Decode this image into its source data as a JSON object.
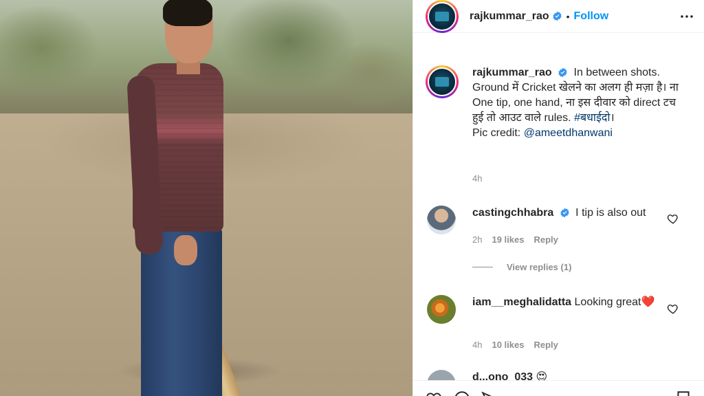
{
  "post": {
    "username": "rajkummar_rao",
    "follow_label": "Follow",
    "separator": "•"
  },
  "caption": {
    "username": "rajkummar_rao",
    "text": "In between shots. Ground में Cricket खेलने का अलग ही मज़ा है। ना One tip, one hand, ना इस दीवार को direct टच हुई तो आउट वाले rules.",
    "hashtag": "#बधाईदो",
    "hashtag_suffix": "।",
    "credit_label": "Pic credit:",
    "credit_mention": "@ameetdhanwani",
    "time": "4h"
  },
  "comments": [
    {
      "username": "castingchhabra",
      "text": "I tip is also out",
      "time": "2h",
      "likes": "19 likes",
      "reply_label": "Reply",
      "view_replies": "View replies (1)"
    },
    {
      "username": "iam__meghalidatta",
      "text": "Looking great❤️",
      "time": "4h",
      "likes": "10 likes",
      "reply_label": "Reply"
    },
    {
      "username": "d...ono_033",
      "text": "😍"
    }
  ],
  "colors": {
    "accent": "#0095f6",
    "link": "#00376b",
    "muted": "#8e8e8e",
    "text": "#262626"
  },
  "icons": [
    "verified-badge-icon",
    "more-options-icon",
    "heart-icon",
    "comment-icon",
    "share-icon",
    "bookmark-icon"
  ]
}
